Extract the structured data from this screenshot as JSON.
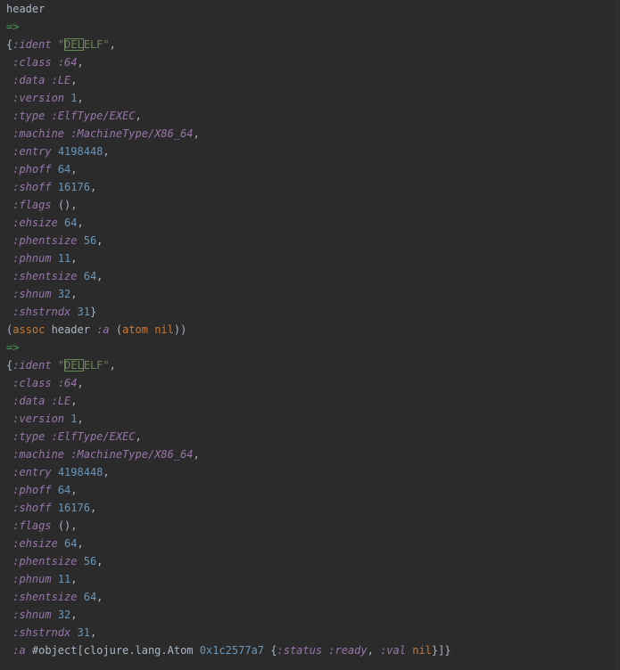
{
  "colors": {
    "background": "#2b2b2b",
    "text": "#a9b7c6",
    "keyword": "#9876aa",
    "number": "#6897bb",
    "string": "#6a8759",
    "function": "#cc7832",
    "prompt": "#499c54"
  },
  "input1": "header",
  "arrow": "=>",
  "ident_open": "{",
  "ident_key": ":ident",
  "ident_q1": " \"",
  "ident_box": "DEL",
  "ident_rest": "ELF\"",
  "comma": ",",
  "fields": {
    "class": {
      "k": ":class",
      "v": ":64"
    },
    "data": {
      "k": ":data",
      "v": ":LE"
    },
    "version": {
      "k": ":version",
      "v": "1"
    },
    "type": {
      "k": ":type",
      "v": ":ElfType/EXEC"
    },
    "machine": {
      "k": ":machine",
      "v": ":MachineType/X86_64"
    },
    "entry": {
      "k": ":entry",
      "v": "4198448"
    },
    "phoff": {
      "k": ":phoff",
      "v": "64"
    },
    "shoff": {
      "k": ":shoff",
      "v": "16176"
    },
    "flags": {
      "k": ":flags",
      "v": "()"
    },
    "ehsize": {
      "k": ":ehsize",
      "v": "64"
    },
    "phentsize": {
      "k": ":phentsize",
      "v": "56"
    },
    "phnum": {
      "k": ":phnum",
      "v": "11"
    },
    "shentsize": {
      "k": ":shentsize",
      "v": "64"
    },
    "shnum": {
      "k": ":shnum",
      "v": "32"
    },
    "shstrndx": {
      "k": ":shstrndx",
      "v": "31"
    }
  },
  "close_brace": "}",
  "input2": {
    "open": "(",
    "fn": "assoc",
    "sp1": " header ",
    "key": ":a",
    "sp2": " (",
    "fn2": "atom",
    "sp3": " ",
    "nil": "nil",
    "close": "))"
  },
  "atom_line": {
    "key": ":a",
    "obj": " #object[clojure.lang.Atom ",
    "addr": "0x1c2577a7",
    "open": " {",
    "status_key": ":status",
    "status_val": " :ready",
    "sep": ", ",
    "val_key": ":val",
    "sp": " ",
    "nil": "nil",
    "close": "}]}"
  }
}
